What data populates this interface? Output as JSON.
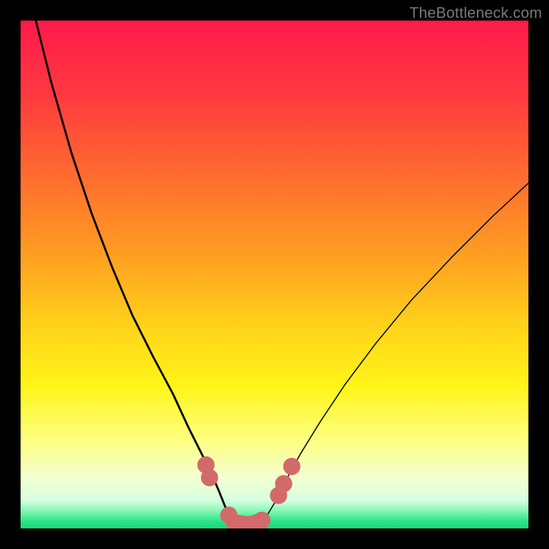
{
  "watermark": {
    "text": "TheBottleneck.com"
  },
  "chart_data": {
    "type": "line",
    "title": "",
    "xlabel": "",
    "ylabel": "",
    "xlim": [
      0,
      100
    ],
    "ylim": [
      0,
      100
    ],
    "grid": false,
    "legend": false,
    "gradient_stops": [
      {
        "offset": 0.0,
        "color": "#ff1a4b"
      },
      {
        "offset": 0.15,
        "color": "#ff3a3f"
      },
      {
        "offset": 0.3,
        "color": "#ff6a2f"
      },
      {
        "offset": 0.45,
        "color": "#ff9a22"
      },
      {
        "offset": 0.6,
        "color": "#ffd21a"
      },
      {
        "offset": 0.72,
        "color": "#fff518"
      },
      {
        "offset": 0.82,
        "color": "#fdff7a"
      },
      {
        "offset": 0.9,
        "color": "#f3ffd0"
      },
      {
        "offset": 0.945,
        "color": "#d6ffe0"
      },
      {
        "offset": 0.965,
        "color": "#88f7b4"
      },
      {
        "offset": 0.985,
        "color": "#2de58a"
      },
      {
        "offset": 1.0,
        "color": "#18d878"
      }
    ],
    "series": [
      {
        "name": "left-branch",
        "x": [
          3,
          6,
          10,
          14,
          18,
          22,
          26,
          30,
          33,
          35.5,
          37.5,
          39,
          40.2,
          41,
          41.8
        ],
        "y": [
          100,
          88,
          74,
          62,
          51.5,
          42,
          34,
          26.5,
          20,
          15,
          11,
          7.5,
          4.5,
          2.5,
          1.3
        ]
      },
      {
        "name": "right-branch",
        "x": [
          47.5,
          48.5,
          50,
          52,
          55,
          59,
          64,
          70,
          77,
          85,
          93,
          100
        ],
        "y": [
          1.3,
          2.5,
          5,
          9,
          14.5,
          21,
          28.5,
          36.5,
          45,
          53.5,
          61.5,
          68
        ]
      },
      {
        "name": "valley-floor",
        "x": [
          41.8,
          43,
          44.5,
          46,
          47.5
        ],
        "y": [
          1.3,
          0.6,
          0.4,
          0.6,
          1.3
        ]
      }
    ],
    "markers": [
      {
        "x": 36.5,
        "y": 12.5,
        "r": 1.7
      },
      {
        "x": 37.2,
        "y": 10.0,
        "r": 1.7
      },
      {
        "x": 41.0,
        "y": 2.6,
        "r": 1.7
      },
      {
        "x": 42.0,
        "y": 1.3,
        "r": 1.7
      },
      {
        "x": 43.5,
        "y": 0.7,
        "r": 1.9
      },
      {
        "x": 45.0,
        "y": 0.6,
        "r": 1.9
      },
      {
        "x": 46.5,
        "y": 0.9,
        "r": 1.9
      },
      {
        "x": 47.5,
        "y": 1.6,
        "r": 1.7
      },
      {
        "x": 50.8,
        "y": 6.5,
        "r": 1.7
      },
      {
        "x": 51.8,
        "y": 8.8,
        "r": 1.7
      },
      {
        "x": 53.4,
        "y": 12.2,
        "r": 1.7
      }
    ],
    "styles": {
      "curve_stroke": "#000000",
      "curve_width_thick": 3.0,
      "curve_width_thin": 1.6,
      "marker_fill": "#d36a6a",
      "valley_stroke": "#d36a6a",
      "valley_width": 14
    }
  }
}
